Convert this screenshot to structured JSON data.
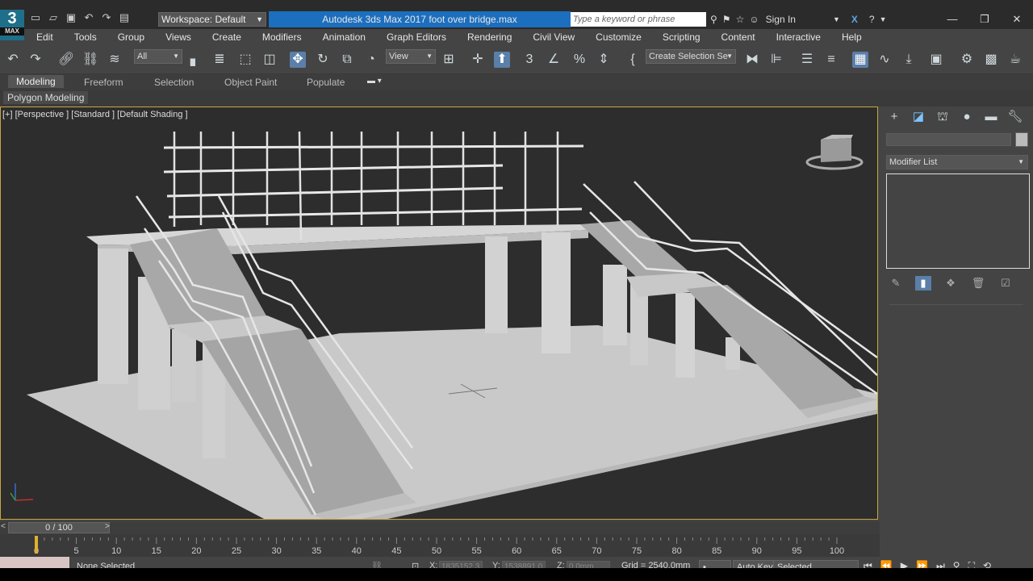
{
  "app": {
    "title": "Autodesk 3ds Max 2017     foot over bridge.max",
    "logo_big": "3",
    "logo_small": "MAX",
    "workspace_label": "Workspace: Default",
    "search_placeholder": "Type a keyword or phrase",
    "sign_in": "Sign In"
  },
  "menu": [
    "Edit",
    "Tools",
    "Group",
    "Views",
    "Create",
    "Modifiers",
    "Animation",
    "Graph Editors",
    "Rendering",
    "Civil View",
    "Customize",
    "Scripting",
    "Content",
    "Interactive",
    "Help"
  ],
  "toolbar": {
    "filter_value": "All",
    "ref_coord_value": "View",
    "selection_set_value": "Create Selection Se"
  },
  "ribbon": {
    "tabs": [
      "Modeling",
      "Freeform",
      "Selection",
      "Object Paint",
      "Populate"
    ],
    "active_tab": "Modeling",
    "sub_label": "Polygon Modeling"
  },
  "viewport": {
    "label": "[+] [Perspective ] [Standard ] [Default Shading ]",
    "viewcube_text": "FRONT"
  },
  "command_panel": {
    "modifier_list": "Modifier List",
    "tabs": [
      "create-icon",
      "modify-icon",
      "hierarchy-icon",
      "motion-icon",
      "display-icon",
      "utilities-icon"
    ],
    "active_tab": "modify-icon"
  },
  "timeline": {
    "frame_display": "0 / 100",
    "ticks": [
      "0",
      "5",
      "10",
      "15",
      "20",
      "25",
      "30",
      "35",
      "40",
      "45",
      "50",
      "55",
      "60",
      "65",
      "70",
      "75",
      "80",
      "85",
      "90",
      "95",
      "100"
    ]
  },
  "status": {
    "selection": "None Selected",
    "x_label": "X:",
    "x_value": "1835152.3",
    "y_label": "Y:",
    "y_value": "1538891.0",
    "z_label": "Z:",
    "z_value": "0.0mm",
    "grid": "Grid = 2540.0mm",
    "auto_key": "Auto Key",
    "selected": "Selected"
  },
  "colors": {
    "title_bar_blue": "#1c6fbf",
    "viewport_border": "#c9a640",
    "active_button": "#5a7fa8"
  }
}
